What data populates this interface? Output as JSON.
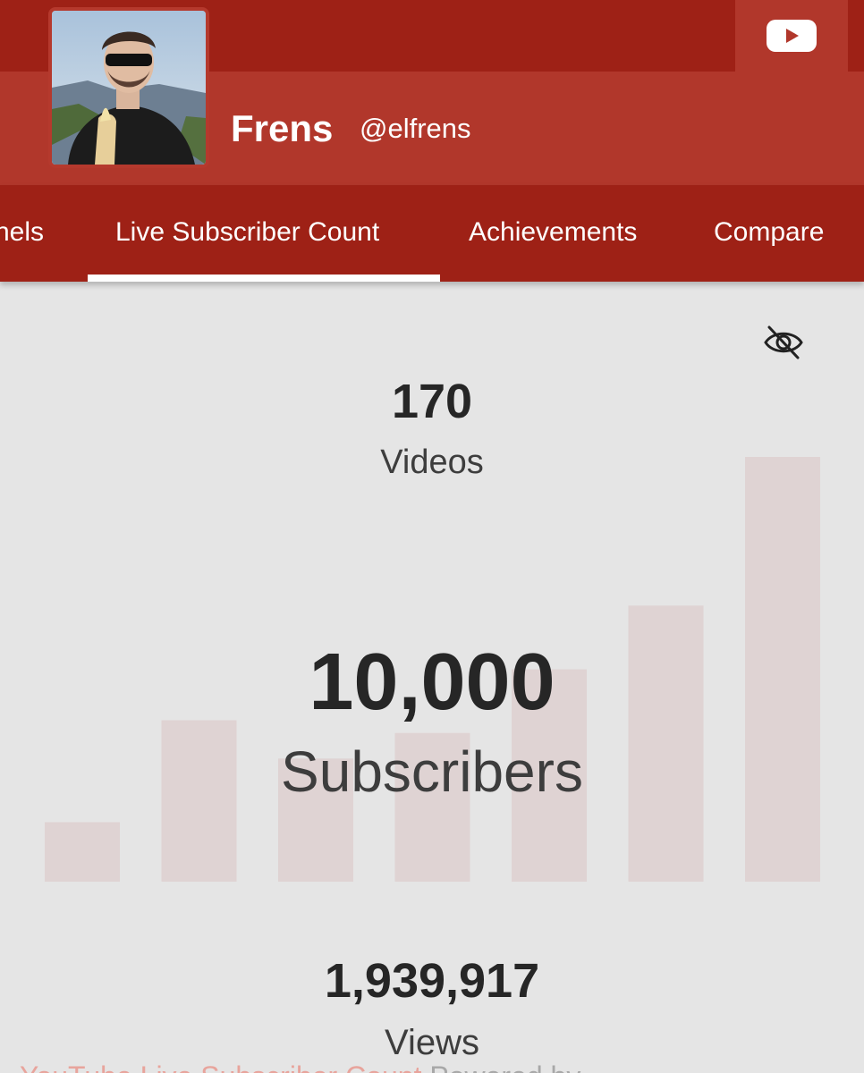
{
  "channel": {
    "name": "Frens",
    "handle": "@elfrens"
  },
  "tabs": [
    {
      "label": "nels"
    },
    {
      "label": "Live Subscriber Count",
      "active": true
    },
    {
      "label": "Achievements"
    },
    {
      "label": "Compare"
    }
  ],
  "stats": {
    "videos": {
      "value": "170",
      "label": "Videos"
    },
    "subscribers": {
      "value": "10,000",
      "label": "Subscribers"
    },
    "views": {
      "value": "1,939,917",
      "label": "Views"
    }
  },
  "footer": {
    "link_text": "YouTube Live Subscriber Count",
    "tail_text": "Powered by"
  },
  "icons": {
    "youtube": "youtube-icon",
    "hide": "eye-off-icon"
  },
  "colors": {
    "brand_dark": "#9e2116",
    "brand": "#b1372b",
    "background": "#e5e5e5",
    "bar": "#dfd3d3"
  },
  "chart_data": {
    "type": "bar",
    "values": [
      14,
      38,
      29,
      35,
      50,
      65,
      100
    ],
    "ylim": [
      0,
      100
    ]
  }
}
